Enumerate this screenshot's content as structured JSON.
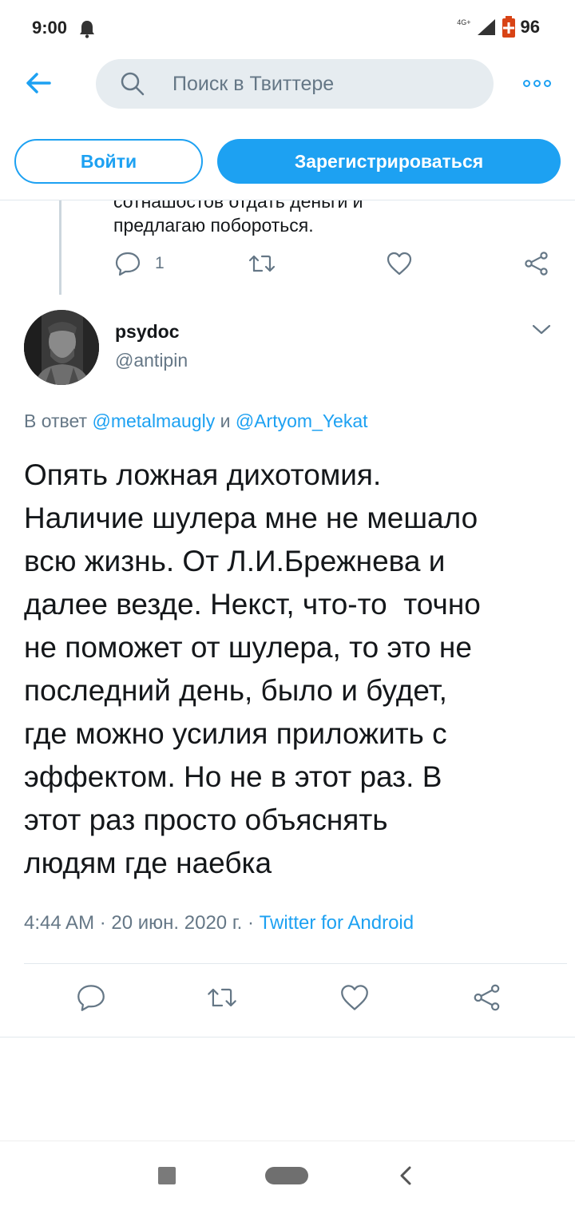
{
  "status_bar": {
    "time": "9:00",
    "network": "4G+",
    "battery": "96"
  },
  "header": {
    "search_placeholder": "Поиск в Твиттере"
  },
  "auth": {
    "login_label": "Войти",
    "signup_label": "Зарегистрироваться"
  },
  "previous_tweet": {
    "cut_text": "сотнашостов отдать деньги и",
    "text": "предлагаю побороться.",
    "reply_count": "1"
  },
  "tweet": {
    "author_name": "psydoc",
    "author_handle": "@antipin",
    "reply_prefix": "В ответ",
    "reply_mention_1": "@metalmaugly",
    "reply_conjunction": "и",
    "reply_mention_2": "@Artyom_Yekat",
    "text": "Опять ложная дихотомия.\nНаличие шулера мне не мешало\nвсю жизнь. От Л.И.Брежнева и\nдалее везде. Некст, что-то  точно\nне поможет от шулера, то это не\nпоследний день, было и будет,\nгде можно усилия приложить с\nэффектом. Но не в этот раз. В\nэтот раз просто объяснять\nлюдям где наебка",
    "time": "4:44 AM",
    "date": "20 июн. 2020 г.",
    "source": "Twitter for Android"
  },
  "colors": {
    "accent": "#1da1f2",
    "secondary_text": "#657786",
    "search_bg": "#e6ecf0",
    "divider": "#e1e8ed"
  },
  "icons": {
    "back": "arrow-left-icon",
    "search": "search-icon",
    "more": "more-dots-icon",
    "reply": "comment-icon",
    "retweet": "retweet-icon",
    "like": "heart-icon",
    "share": "share-icon",
    "caret": "chevron-down-icon"
  }
}
